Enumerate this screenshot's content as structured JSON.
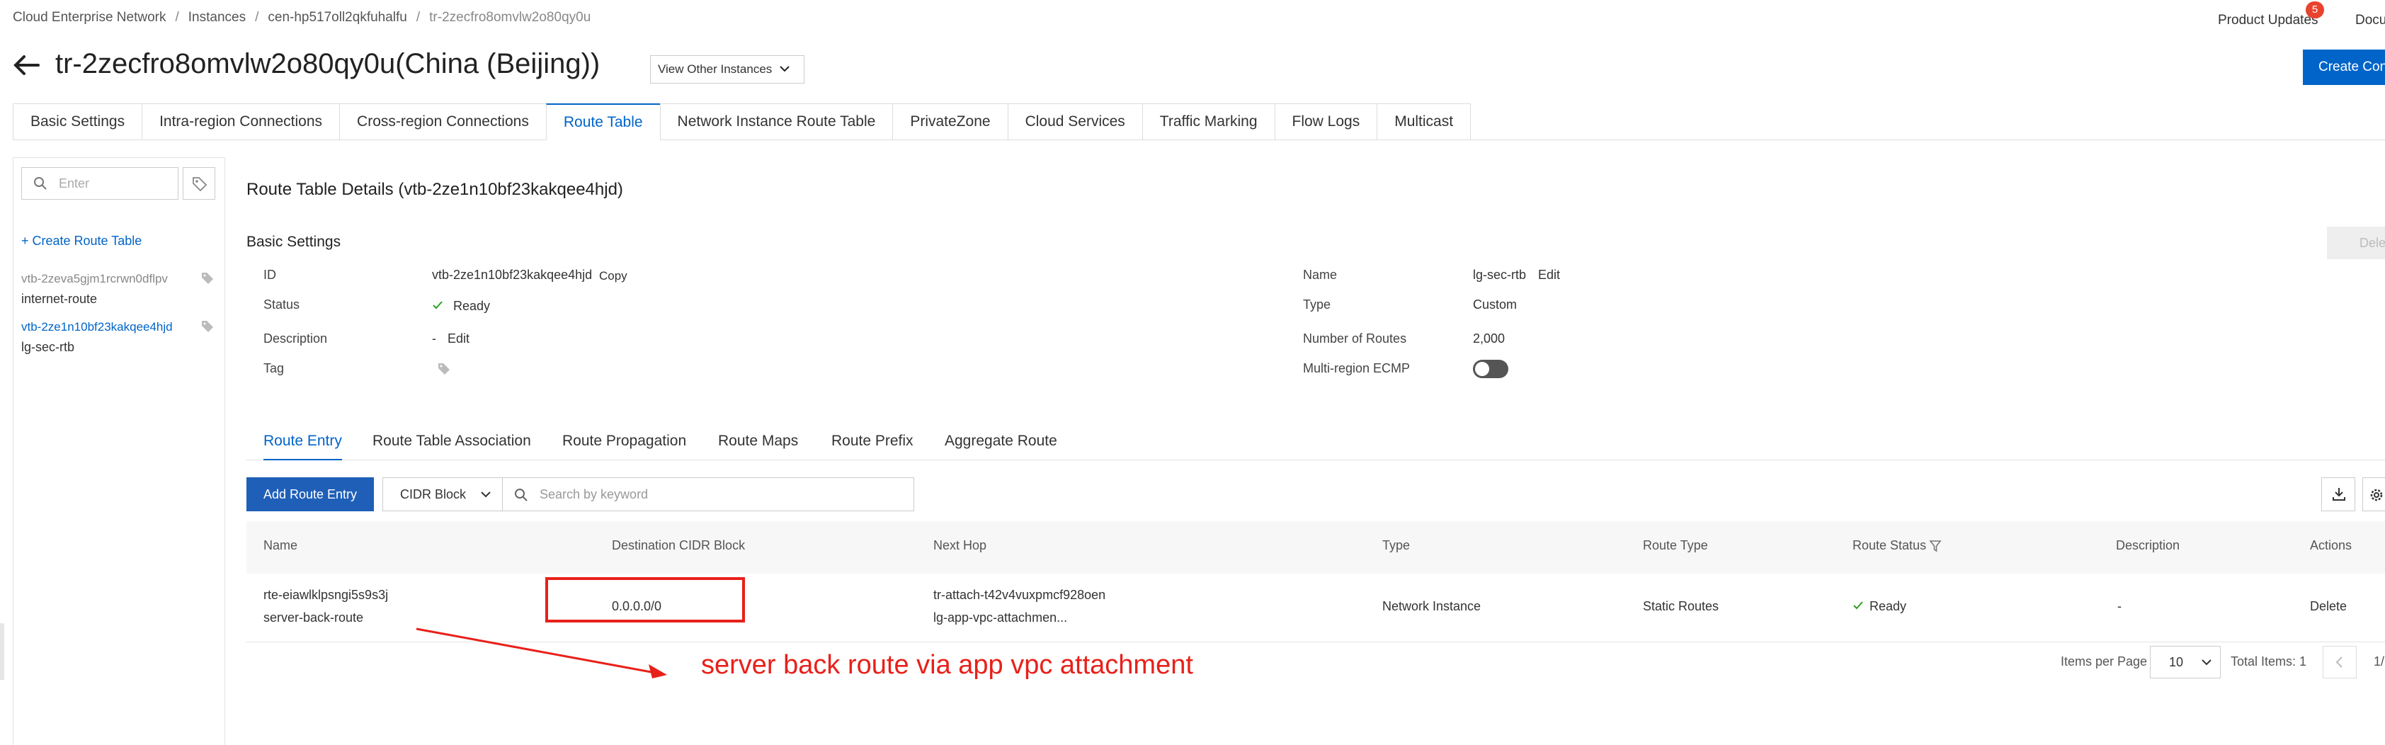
{
  "breadcrumb": [
    "Cloud Enterprise Network",
    "Instances",
    "cen-hp517oll2qkfuhalfu",
    "tr-2zecfro8omvlw2o80qy0u"
  ],
  "header": {
    "product_updates": "Product Updates",
    "product_updates_count": "5",
    "docs": "Docu",
    "title": "tr-2zecfro8omvlw2o80qy0u(China (Beijing))",
    "view_other": "View Other Instances",
    "create_button": "Create Conn"
  },
  "tabs": [
    "Basic Settings",
    "Intra-region Connections",
    "Cross-region Connections",
    "Route Table",
    "Network Instance Route Table",
    "PrivateZone",
    "Cloud Services",
    "Traffic Marking",
    "Flow Logs",
    "Multicast"
  ],
  "sidebar": {
    "search_placeholder": "Enter",
    "create_label": "+ Create Route Table",
    "items": [
      {
        "id": "vtb-2zeva5gjm1rcrwn0dflpv",
        "name": "internet-route"
      },
      {
        "id": "vtb-2ze1n10bf23kakqee4hjd",
        "name": "lg-sec-rtb"
      }
    ]
  },
  "details": {
    "title": "Route Table Details (vtb-2ze1n10bf23kakqee4hjd)",
    "section": "Basic Settings",
    "delete_label": "Delete",
    "id_label": "ID",
    "id_value": "vtb-2ze1n10bf23kakqee4hjd",
    "copy_label": "Copy",
    "status_label": "Status",
    "status_value": "Ready",
    "description_label": "Description",
    "description_value": "-",
    "edit_label": "Edit",
    "tag_label": "Tag",
    "name_label": "Name",
    "name_value": "lg-sec-rtb",
    "type_label": "Type",
    "type_value": "Custom",
    "routes_label": "Number of Routes",
    "routes_value": "2,000",
    "ecmp_label": "Multi-region ECMP",
    "ecmp_enabled": false
  },
  "subtabs": [
    "Route Entry",
    "Route Table Association",
    "Route Propagation",
    "Route Maps",
    "Route Prefix",
    "Aggregate Route"
  ],
  "toolbar": {
    "add_label": "Add Route Entry",
    "filter_label": "CIDR Block",
    "search_placeholder": "Search by keyword"
  },
  "table": {
    "columns": [
      "Name",
      "Destination CIDR Block",
      "Next Hop",
      "Type",
      "Route Type",
      "Route Status",
      "Description",
      "Actions"
    ],
    "rows": [
      {
        "id": "rte-eiawlklpsngi5s9s3j",
        "name": "server-back-route",
        "cidr": "0.0.0.0/0",
        "next_hop_id": "tr-attach-t42v4vuxpmcf928oen",
        "next_hop_name": "lg-app-vpc-attachmen...",
        "type": "Network Instance",
        "route_type": "Static Routes",
        "status": "Ready",
        "description": "-",
        "action": "Delete"
      }
    ]
  },
  "pagination": {
    "items_label": "Items per Page",
    "per_page": "10",
    "total": "Total Items: 1",
    "page": "1/"
  },
  "annotation": "server back route via app vpc attachment",
  "colors": {
    "accent": "#0064c8",
    "annotation": "#e8201a",
    "ready": "#2ea121"
  }
}
